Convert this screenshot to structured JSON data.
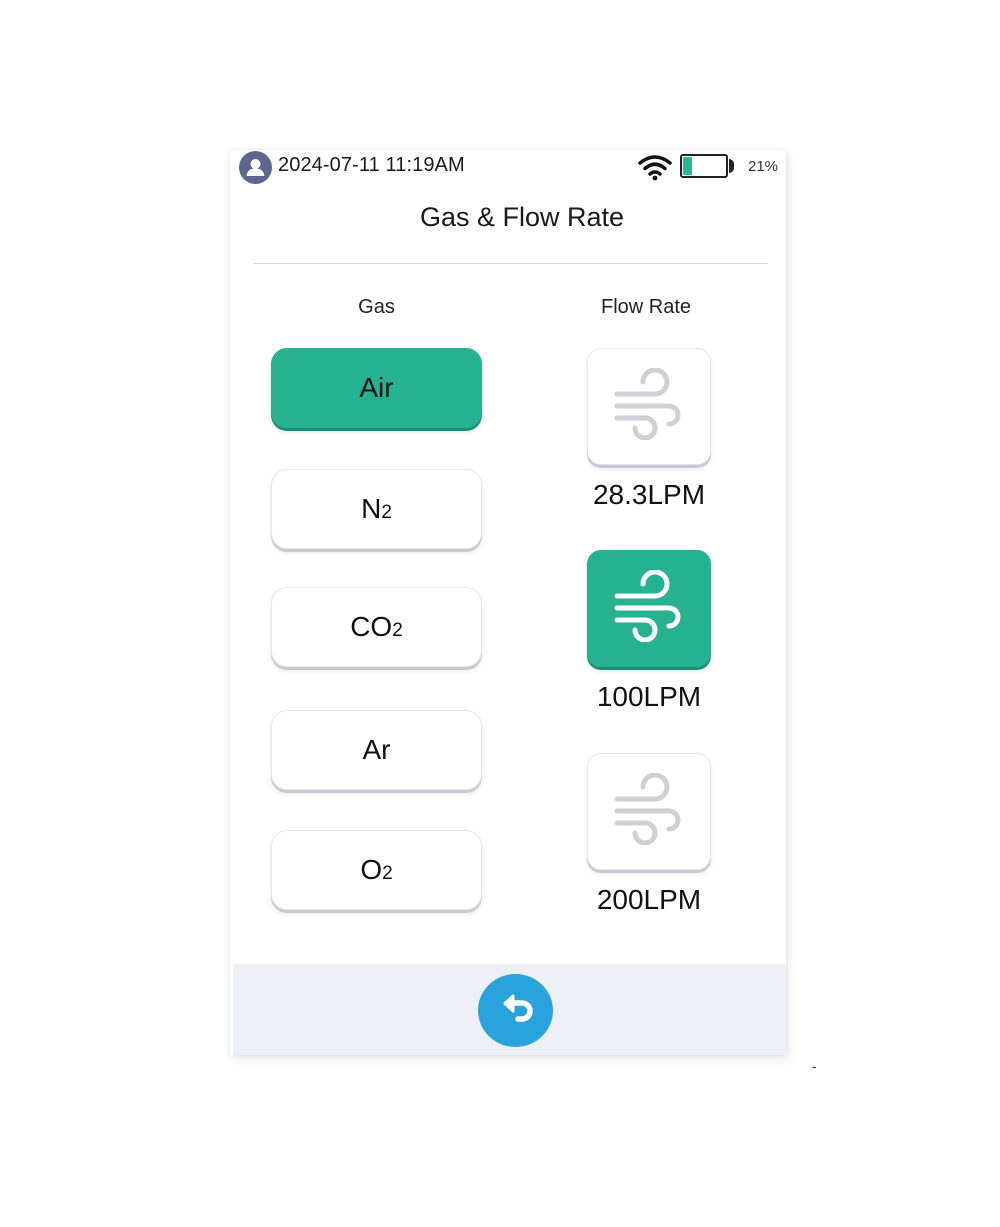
{
  "status": {
    "datetime": "2024-07-11 11:19AM",
    "battery_percent_label": "21%",
    "battery_level": 0.21,
    "icons": {
      "user": "user-avatar-icon",
      "wifi": "wifi-icon",
      "battery": "battery-icon"
    }
  },
  "page": {
    "title": "Gas & Flow Rate"
  },
  "gas": {
    "heading": "Gas",
    "options": [
      {
        "main": "Air",
        "sub": "",
        "selected": true
      },
      {
        "main": "N",
        "sub": "2",
        "selected": false
      },
      {
        "main": "CO",
        "sub": "2",
        "selected": false
      },
      {
        "main": "Ar",
        "sub": "",
        "selected": false
      },
      {
        "main": "O",
        "sub": "2",
        "selected": false
      }
    ]
  },
  "flow": {
    "heading": "Flow Rate",
    "icon": "wind-icon",
    "options": [
      {
        "label": "28.3LPM",
        "selected": false
      },
      {
        "label": "100LPM",
        "selected": true
      },
      {
        "label": "200LPM",
        "selected": false
      }
    ]
  },
  "footer": {
    "back_icon": "back-arrow-icon",
    "corner_mark": "-"
  },
  "colors": {
    "accent": "#26b290",
    "back_button": "#2aa3dd",
    "footer_bg": "#eef0f7",
    "avatar": "#5e6690",
    "icon_inactive": "#cfcfd4",
    "icon_active": "#ffffff"
  }
}
